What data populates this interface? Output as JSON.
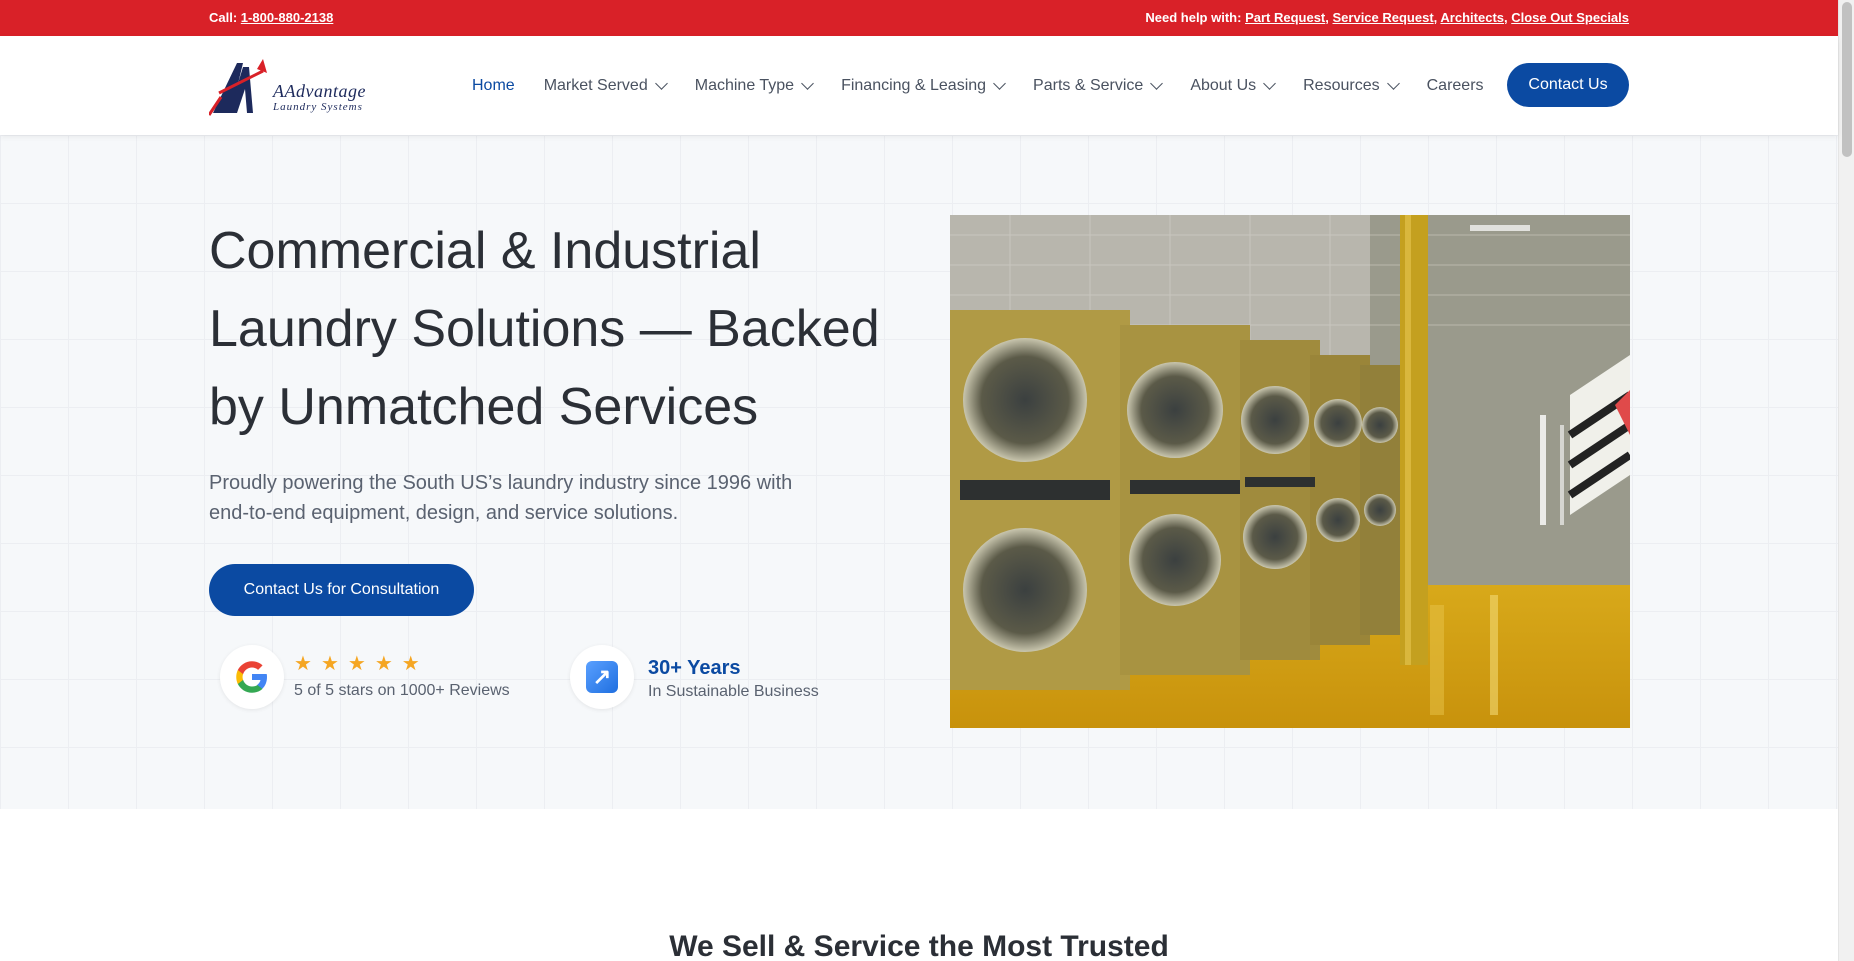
{
  "topbar": {
    "call_label": "Call:",
    "phone": "1-800-880-2138",
    "help_label": "Need help with:",
    "links": [
      "Part Request",
      "Service Request",
      "Architects",
      "Close Out Specials"
    ]
  },
  "logo": {
    "line1": "AAdvantage",
    "line2": "Laundry Systems"
  },
  "nav": {
    "items": [
      {
        "label": "Home",
        "dropdown": false
      },
      {
        "label": "Market Served",
        "dropdown": true
      },
      {
        "label": "Machine Type",
        "dropdown": true
      },
      {
        "label": "Financing & Leasing",
        "dropdown": true
      },
      {
        "label": "Parts & Service",
        "dropdown": true
      },
      {
        "label": "About Us",
        "dropdown": true
      },
      {
        "label": "Resources",
        "dropdown": true
      },
      {
        "label": "Careers",
        "dropdown": false
      }
    ],
    "contact_button": "Contact Us"
  },
  "hero": {
    "title": "Commercial & Industrial Laundry Solutions — Backed by Unmatched Services",
    "subtitle": "Proudly powering the South US’s laundry industry since 1996 with end-to-end equipment, design, and service solutions.",
    "cta": "Contact Us for Consultation",
    "rating": {
      "stars": 5,
      "text": "5 of 5 stars on 1000+ Reviews",
      "icon": "google-g-icon"
    },
    "years": {
      "value": "30+ Years",
      "text": "In Sustainable Business",
      "icon": "arrow-up-right-icon"
    }
  },
  "section": {
    "title": "We Sell & Service the Most Trusted"
  },
  "colors": {
    "topbar": "#d92128",
    "primary": "#0b4aa2",
    "star": "#f5a623"
  }
}
